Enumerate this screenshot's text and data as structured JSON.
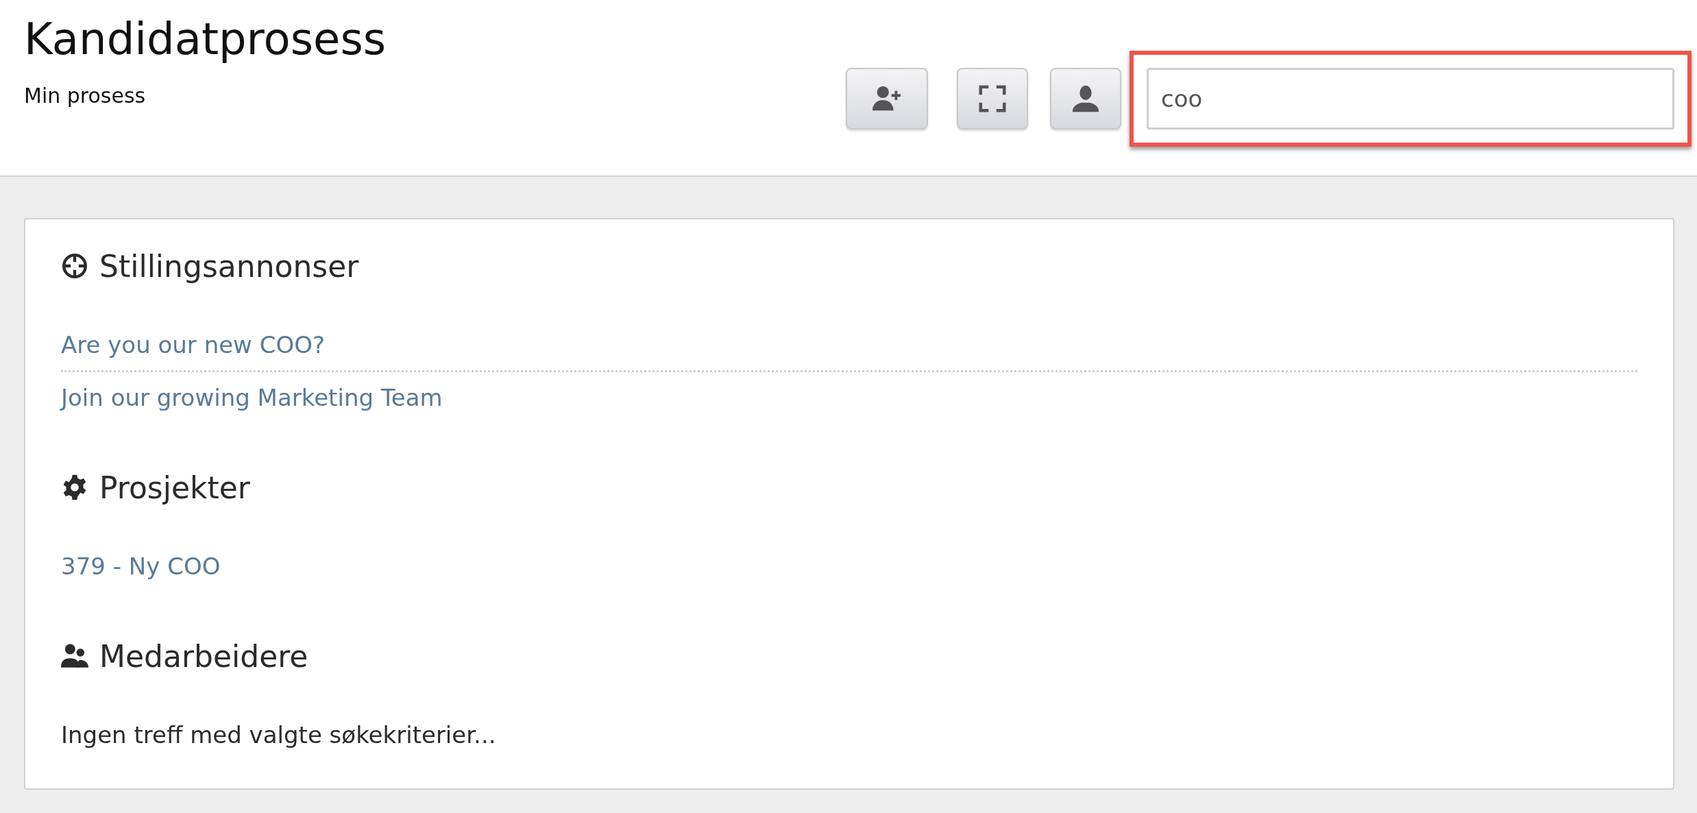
{
  "header": {
    "title": "Kandidatprosess",
    "subtitle": "Min prosess"
  },
  "toolbar": {
    "buttons": [
      {
        "kind": "add-person"
      },
      {
        "kind": "fullscreen"
      },
      {
        "kind": "person"
      }
    ],
    "search": {
      "value": "coo",
      "highlighted": true
    }
  },
  "sections": [
    {
      "kind": "target",
      "title": "Stillingsannonser",
      "items": [
        {
          "kind": "link",
          "text": "Are you our new COO?"
        },
        {
          "kind": "link",
          "text": "Join our growing Marketing Team"
        }
      ]
    },
    {
      "kind": "gear",
      "title": "Prosjekter",
      "items": [
        {
          "kind": "link",
          "text": "379 - Ny COO"
        }
      ]
    },
    {
      "kind": "people",
      "title": "Medarbeidere",
      "items": [
        {
          "kind": "empty",
          "text": "Ingen treff med valgte søkekriterier..."
        }
      ]
    }
  ]
}
